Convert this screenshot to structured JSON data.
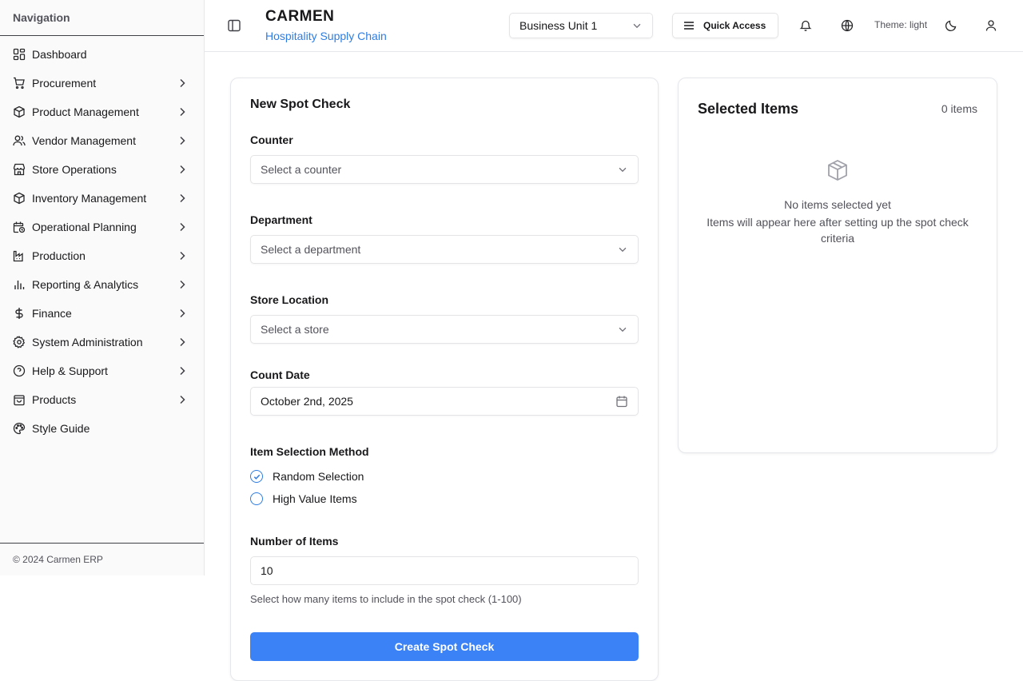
{
  "sidebar": {
    "header": "Navigation",
    "items": [
      {
        "label": "Dashboard",
        "icon": "dashboard-icon",
        "has_children": false
      },
      {
        "label": "Procurement",
        "icon": "cart-icon",
        "has_children": true
      },
      {
        "label": "Product Management",
        "icon": "package-icon",
        "has_children": true
      },
      {
        "label": "Vendor Management",
        "icon": "users-icon",
        "has_children": true
      },
      {
        "label": "Store Operations",
        "icon": "store-icon",
        "has_children": true
      },
      {
        "label": "Inventory Management",
        "icon": "package-icon",
        "has_children": true
      },
      {
        "label": "Operational Planning",
        "icon": "calendar-clock-icon",
        "has_children": true
      },
      {
        "label": "Production",
        "icon": "factory-icon",
        "has_children": true
      },
      {
        "label": "Reporting & Analytics",
        "icon": "bar-chart-icon",
        "has_children": true
      },
      {
        "label": "Finance",
        "icon": "dollar-icon",
        "has_children": true
      },
      {
        "label": "System Administration",
        "icon": "gear-icon",
        "has_children": true
      },
      {
        "label": "Help & Support",
        "icon": "help-circle-icon",
        "has_children": true
      },
      {
        "label": "Products",
        "icon": "shopping-bag-icon",
        "has_children": true
      },
      {
        "label": "Style Guide",
        "icon": "palette-icon",
        "has_children": false
      }
    ],
    "footer": "© 2024 Carmen ERP"
  },
  "header": {
    "title": "CARMEN",
    "subtitle": "Hospitality Supply Chain",
    "business_unit": "Business Unit 1",
    "quick_access": "Quick Access",
    "theme_label": "Theme: light"
  },
  "form": {
    "title": "New Spot Check",
    "counter_label": "Counter",
    "counter_placeholder": "Select a counter",
    "department_label": "Department",
    "department_placeholder": "Select a department",
    "store_label": "Store Location",
    "store_placeholder": "Select a store",
    "date_label": "Count Date",
    "date_value": "October 2nd, 2025",
    "method_label": "Item Selection Method",
    "methods": [
      {
        "label": "Random Selection",
        "selected": true
      },
      {
        "label": "High Value Items",
        "selected": false
      }
    ],
    "num_label": "Number of Items",
    "num_value": "10",
    "num_helper": "Select how many items to include in the spot check (1-100)",
    "submit_label": "Create Spot Check"
  },
  "selected": {
    "title": "Selected Items",
    "count": "0 items",
    "empty_title": "No items selected yet",
    "empty_desc": "Items will appear here after setting up the spot check criteria"
  },
  "colors": {
    "accent": "#3b82f6",
    "link": "#2f7de1"
  }
}
